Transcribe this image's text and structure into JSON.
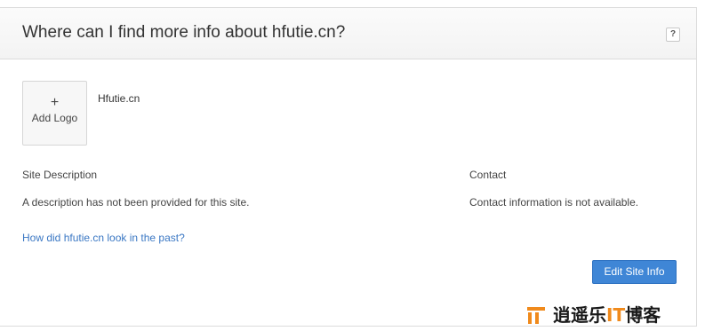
{
  "panel": {
    "title": "Where can I find more info about hfutie.cn?",
    "help_label": "?"
  },
  "logo": {
    "plus": "+",
    "label": "Add Logo"
  },
  "site": {
    "name": "Hfutie.cn"
  },
  "description": {
    "label": "Site Description",
    "text": "A description has not been provided for this site."
  },
  "contact": {
    "label": "Contact",
    "text": "Contact information is not available."
  },
  "past_link": "How did hfutie.cn look in the past?",
  "edit_button": "Edit Site Info",
  "watermark": {
    "prefix": "逍遥乐",
    "accent": "IT",
    "suffix": "博客",
    "icon": "it-logo-icon"
  },
  "colors": {
    "accent": "#3f86d6",
    "link": "#3b78c4",
    "watermark_accent": "#f08a1c"
  }
}
